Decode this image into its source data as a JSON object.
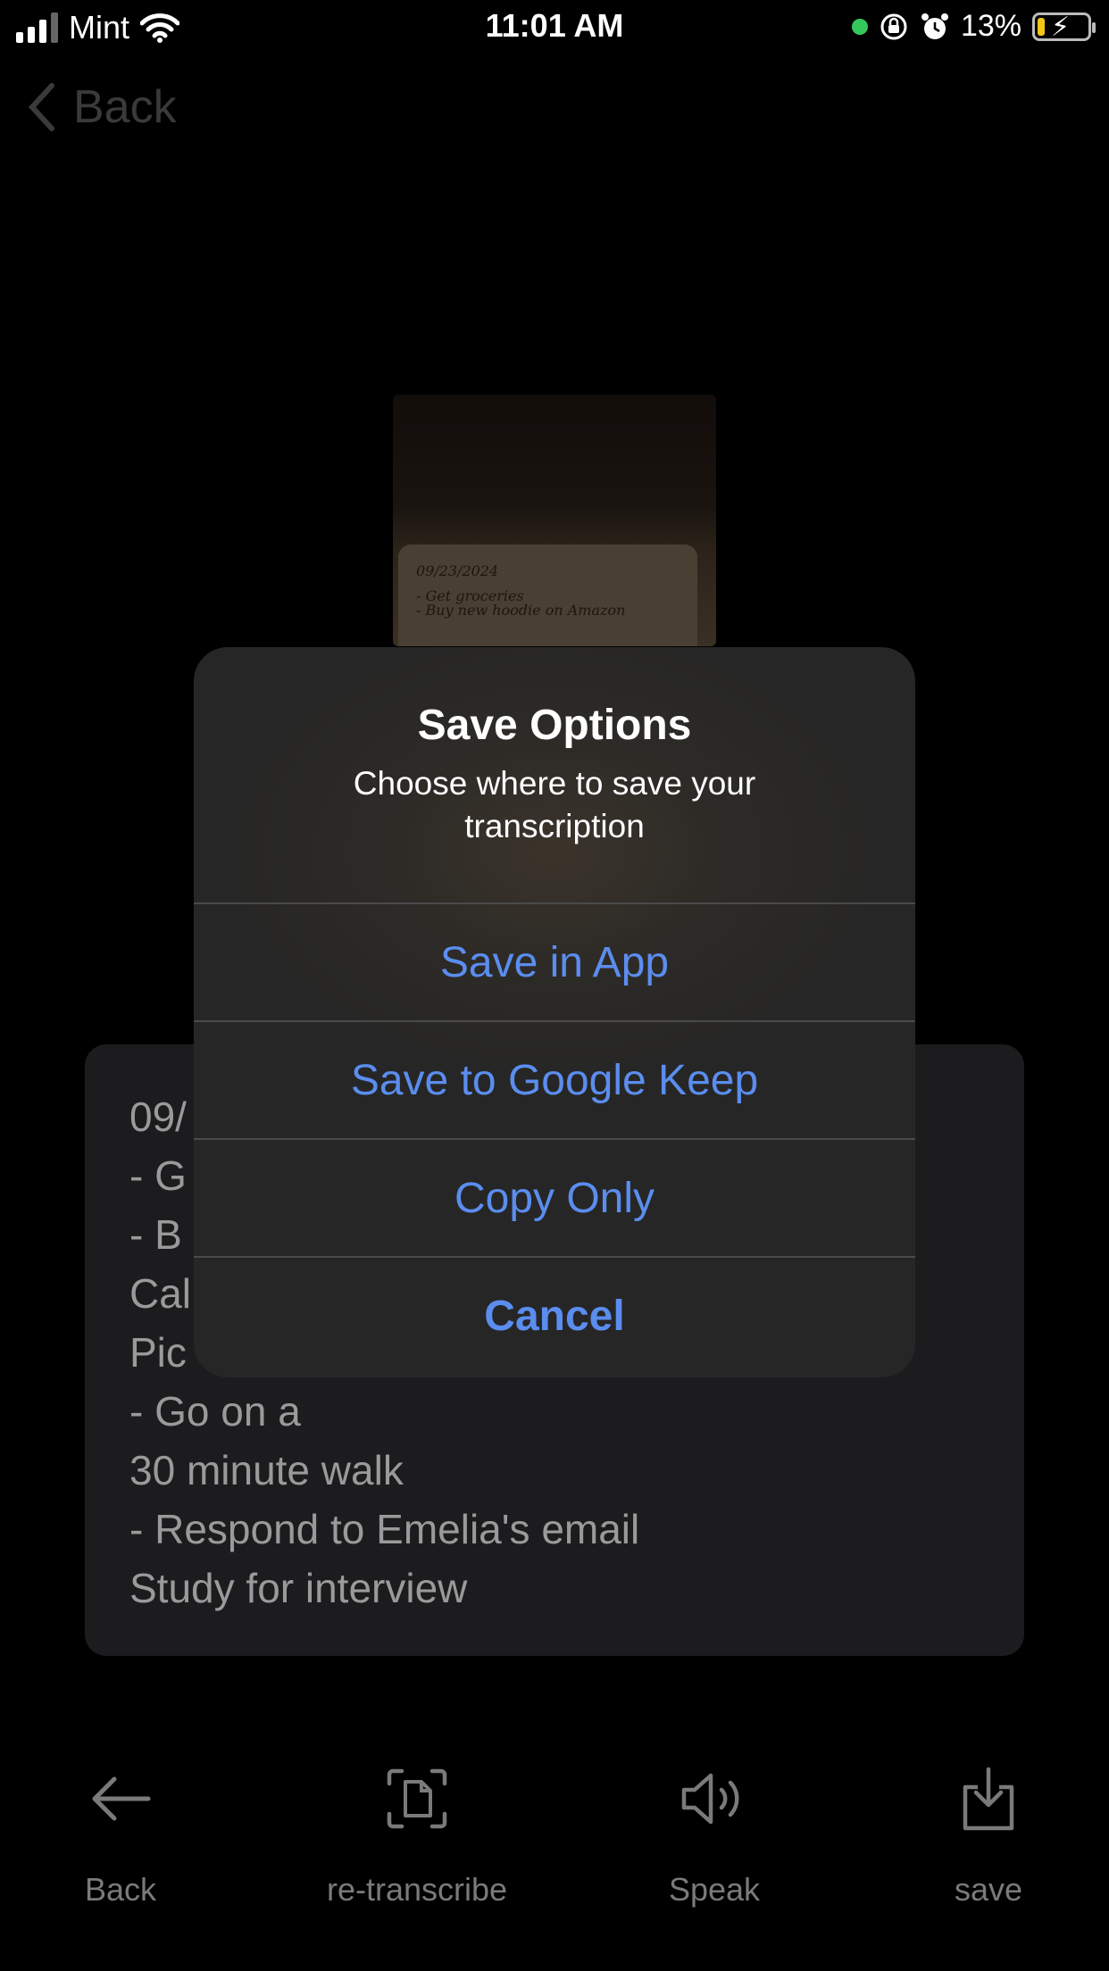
{
  "status_bar": {
    "carrier": "Mint",
    "time": "11:01 AM",
    "battery_percent": "13%"
  },
  "nav": {
    "back_label": "Back"
  },
  "thumbnail": {
    "lines": [
      "09/23/2024",
      "- Get groceries",
      "- Buy new hoodie on Amazon"
    ]
  },
  "transcription": {
    "lines": [
      "09/",
      "- G",
      "- B",
      "Cal",
      "Pic",
      "- Go on a",
      "30 minute walk",
      "- Respond to Emelia's email",
      "Study for interview"
    ]
  },
  "dialog": {
    "title": "Save Options",
    "message": "Choose where to save your transcription",
    "buttons": {
      "save_in_app": "Save in App",
      "save_google_keep": "Save to Google Keep",
      "copy_only": "Copy Only",
      "cancel": "Cancel"
    },
    "accent_color": "#5b8def"
  },
  "toolbar": {
    "back": "Back",
    "retranscribe": "re-transcribe",
    "speak": "Speak",
    "save": "save"
  }
}
